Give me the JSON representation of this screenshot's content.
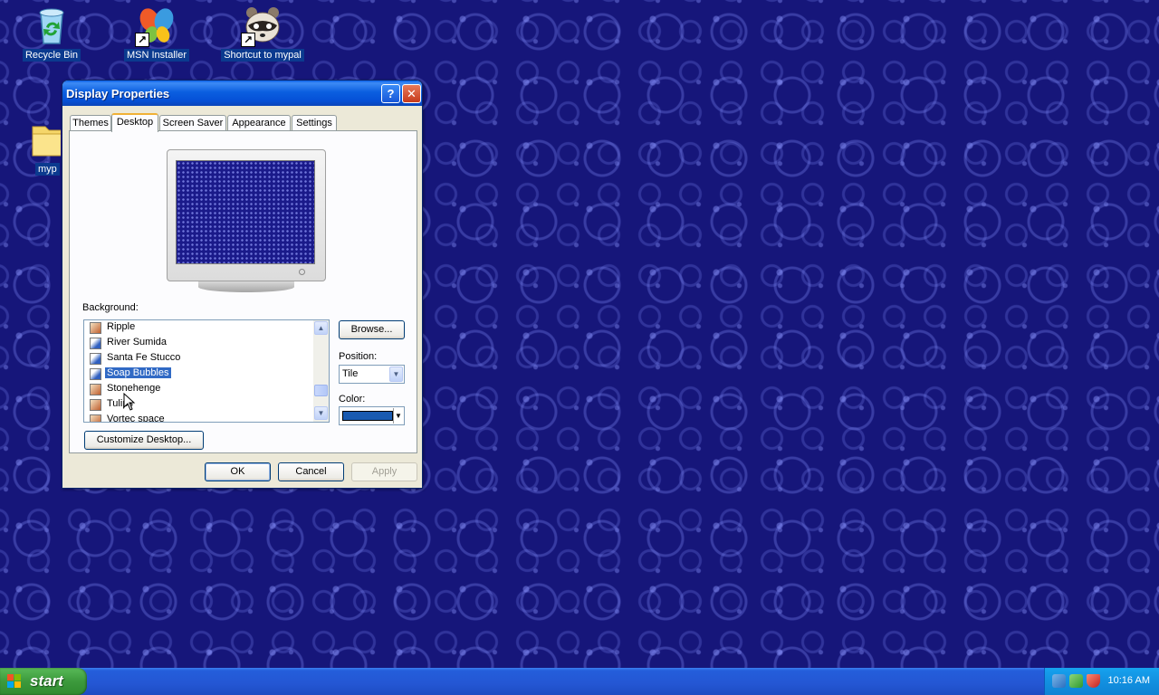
{
  "desktop": {
    "icons": [
      {
        "label": "Recycle Bin"
      },
      {
        "label": "MSN Installer"
      },
      {
        "label": "Shortcut to mypal"
      },
      {
        "label": "myp"
      }
    ]
  },
  "window": {
    "title": "Display Properties",
    "help_glyph": "?",
    "close_glyph": "✕",
    "tabs": [
      {
        "label": "Themes"
      },
      {
        "label": "Desktop",
        "active": true
      },
      {
        "label": "Screen Saver"
      },
      {
        "label": "Appearance"
      },
      {
        "label": "Settings"
      }
    ],
    "background_label": "Background:",
    "background_items": [
      {
        "label": "Ripple"
      },
      {
        "label": "River Sumida"
      },
      {
        "label": "Santa Fe Stucco"
      },
      {
        "label": "Soap Bubbles",
        "selected": true
      },
      {
        "label": "Stonehenge"
      },
      {
        "label": "Tulips"
      },
      {
        "label": "Vortec space"
      }
    ],
    "browse_label": "Browse...",
    "position_label": "Position:",
    "position_value": "Tile",
    "color_label": "Color:",
    "color_value": "#1a5ab0",
    "customize_label": "Customize Desktop...",
    "ok_label": "OK",
    "cancel_label": "Cancel",
    "apply_label": "Apply"
  },
  "taskbar": {
    "start_label": "start",
    "clock": "10:16 AM"
  }
}
